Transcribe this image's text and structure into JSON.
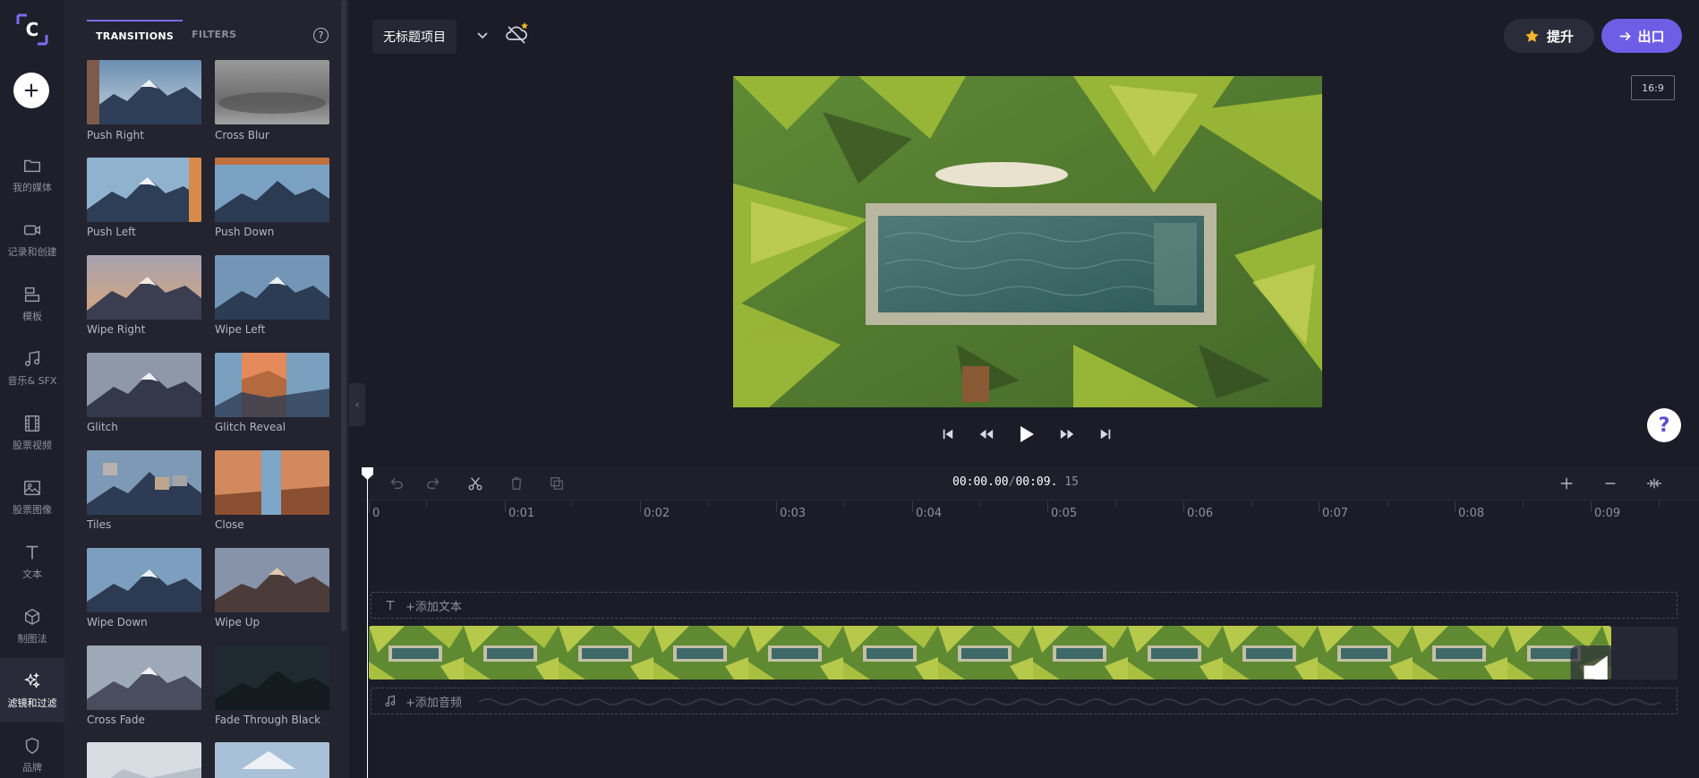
{
  "nav": {
    "items": [
      {
        "label": "我的媒体",
        "icon": "folder-icon"
      },
      {
        "label": "记录和创建",
        "icon": "video-camera-icon"
      },
      {
        "label": "模板",
        "icon": "template-icon"
      },
      {
        "label": "音乐& SFX",
        "icon": "music-note-icon"
      },
      {
        "label": "股票视频",
        "icon": "film-icon"
      },
      {
        "label": "股票图像",
        "icon": "image-icon"
      },
      {
        "label": "文本",
        "icon": "text-icon"
      },
      {
        "label": "制图法",
        "icon": "cube-icon"
      },
      {
        "label": "滤镜和过滤",
        "icon": "sparkles-icon"
      },
      {
        "label": "品牌",
        "icon": "shield-icon"
      }
    ]
  },
  "panel": {
    "tabs": [
      "TRANSITIONS",
      "FILTERS"
    ],
    "help_symbol": "?",
    "transitions": [
      "Push Right",
      "Cross Blur",
      "Push Left",
      "Push Down",
      "Wipe Right",
      "Wipe Left",
      "Glitch",
      "Glitch Reveal",
      "Tiles",
      "Close",
      "Wipe Down",
      "Wipe Up",
      "Cross Fade",
      "Fade Through Black"
    ]
  },
  "topbar": {
    "project_name": "无标题项目",
    "upgrade_label": "提升",
    "export_label": "出口",
    "aspect_ratio": "16:9"
  },
  "help_symbol": "?",
  "timeline": {
    "timecode_current": "00:00.00",
    "timecode_sep": "/",
    "timecode_total_main": "00:09.",
    "timecode_total_frames": "15",
    "ticks": [
      "0",
      "0:01",
      "0:02",
      "0:03",
      "0:04",
      "0:05",
      "0:06",
      "0:07",
      "0:08",
      "0:09"
    ],
    "add_text_label": "+添加文本",
    "add_audio_label": "+添加音频"
  },
  "colors": {
    "accent": "#6e5ee6",
    "background": "#1b1c27",
    "panel": "#232430"
  }
}
